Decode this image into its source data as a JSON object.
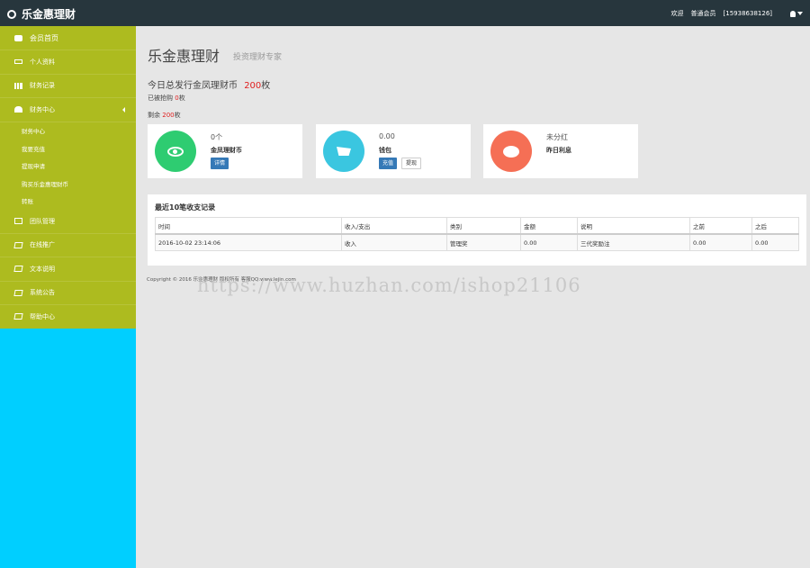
{
  "header": {
    "brand": "乐金惠理财",
    "welcome": "欢迎",
    "user_level": "普通会员",
    "phone": "[15938638126]"
  },
  "sidebar": {
    "home": "会员首页",
    "items": [
      {
        "label": "个人资料",
        "icon": "monitor-icon"
      },
      {
        "label": "财务记录",
        "icon": "chart-icon"
      },
      {
        "label": "财务中心",
        "icon": "people-icon",
        "expanded": true
      },
      {
        "label": "团队管理",
        "icon": "grid-icon"
      },
      {
        "label": "在线推广",
        "icon": "edit-icon"
      },
      {
        "label": "文本说明",
        "icon": "edit-icon"
      },
      {
        "label": "系统公告",
        "icon": "edit-icon"
      },
      {
        "label": "帮助中心",
        "icon": "edit-icon"
      }
    ],
    "subitems": [
      "财务中心",
      "我要充值",
      "提现申请",
      "购买乐金惠理财币",
      "转账"
    ]
  },
  "main": {
    "title": "乐金惠理财",
    "subtitle": "投资理财专家",
    "summary": {
      "prefix": "今日总发行金凤理财币",
      "amount": "200",
      "unit": "枚"
    },
    "grabbed": {
      "label": "已被抢购",
      "amount": "0",
      "unit": "枚"
    },
    "remaining": {
      "label": "剩余",
      "amount": "200",
      "unit": "枚"
    }
  },
  "cards": [
    {
      "value": "0个",
      "label": "金凤理财币",
      "buttons": [
        "详情"
      ],
      "color": "#2ecc71",
      "icon": "eye-icon"
    },
    {
      "value": "0.00",
      "label": "钱包",
      "buttons": [
        "充值",
        "提现"
      ],
      "color": "#3ac6e0",
      "icon": "cart-icon"
    },
    {
      "value": "未分红",
      "label": "昨日利息",
      "buttons": [],
      "color": "#f56f55",
      "icon": "chat-icon"
    }
  ],
  "records": {
    "title": "最近10笔收支记录",
    "columns": [
      "时间",
      "收入/支出",
      "类别",
      "金额",
      "说明",
      "之前",
      "之后"
    ],
    "rows": [
      [
        "2016-10-02 23:14:06",
        "收入",
        "管理奖",
        "0.00",
        "三代奖励注",
        "0.00",
        "0.00"
      ]
    ]
  },
  "footer": "Copyright © 2016 乐金惠理财 版权所有 客服QQ:www.lejin.com",
  "watermark": "https://www.huzhan.com/ishop21106",
  "colors": {
    "topbar": "#27363d",
    "sidebar": "#adbb1f",
    "sidebar_fill": "#00cfff",
    "accent_red": "#e02020"
  }
}
